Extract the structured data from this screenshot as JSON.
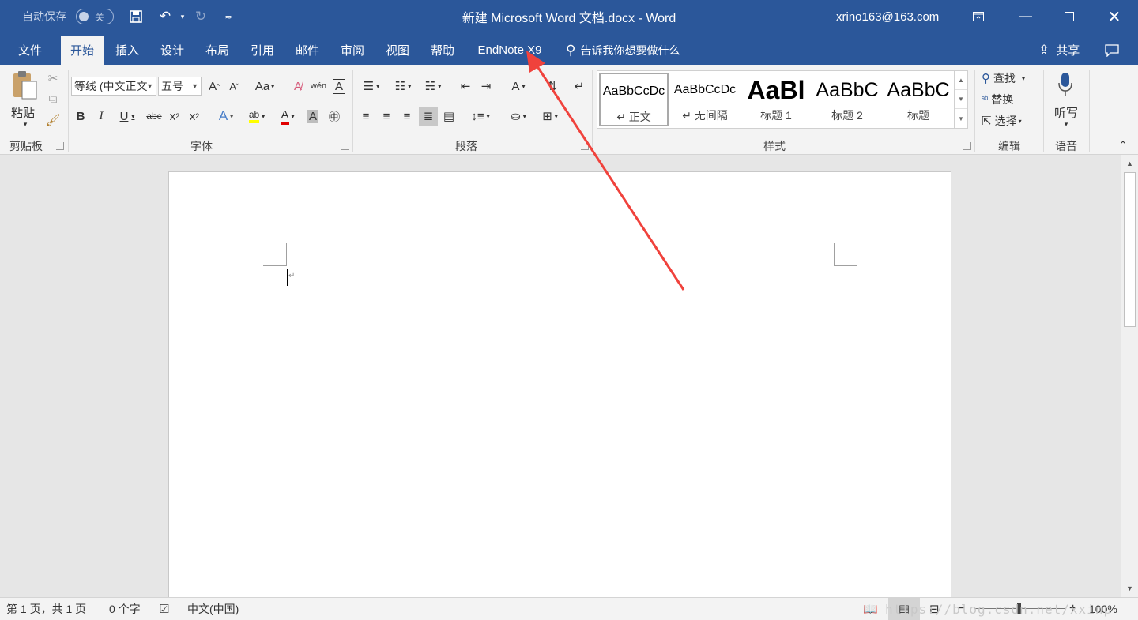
{
  "titlebar": {
    "autosave_label": "自动保存",
    "autosave_state": "关",
    "doc_title": "新建 Microsoft Word 文档.docx  -  Word",
    "account": "xrino163@163.com"
  },
  "tabs": [
    {
      "label": "文件"
    },
    {
      "label": "开始"
    },
    {
      "label": "插入"
    },
    {
      "label": "设计"
    },
    {
      "label": "布局"
    },
    {
      "label": "引用"
    },
    {
      "label": "邮件"
    },
    {
      "label": "审阅"
    },
    {
      "label": "视图"
    },
    {
      "label": "帮助"
    },
    {
      "label": "EndNote X9"
    }
  ],
  "tellme": "告诉我你想要做什么",
  "share": "共享",
  "ribbon": {
    "clipboard": {
      "paste": "粘贴",
      "label": "剪贴板"
    },
    "font": {
      "font_name": "等线 (中文正文",
      "font_size": "五号",
      "label": "字体"
    },
    "paragraph": {
      "label": "段落"
    },
    "styles": {
      "label": "样式",
      "items": [
        {
          "sample": "AaBbCcDc",
          "name": "↵ 正文"
        },
        {
          "sample": "AaBbCcDc",
          "name": "↵ 无间隔"
        },
        {
          "sample": "AaBl",
          "name": "标题 1"
        },
        {
          "sample": "AaBbC",
          "name": "标题 2"
        },
        {
          "sample": "AaBbC",
          "name": "标题"
        }
      ]
    },
    "editing": {
      "find": "查找",
      "replace": "替换",
      "select": "选择",
      "label": "编辑"
    },
    "voice": {
      "dictate": "听写",
      "label": "语音"
    }
  },
  "document": {
    "para_mark": "↵"
  },
  "statusbar": {
    "page": "第 1 页，共 1 页",
    "words": "0 个字",
    "language": "中文(中国)",
    "zoom": "100%",
    "watermark": "https://blog.csdn.net/xxinp"
  },
  "colors": {
    "brand": "#2b579a",
    "annotation": "#f0423c"
  }
}
